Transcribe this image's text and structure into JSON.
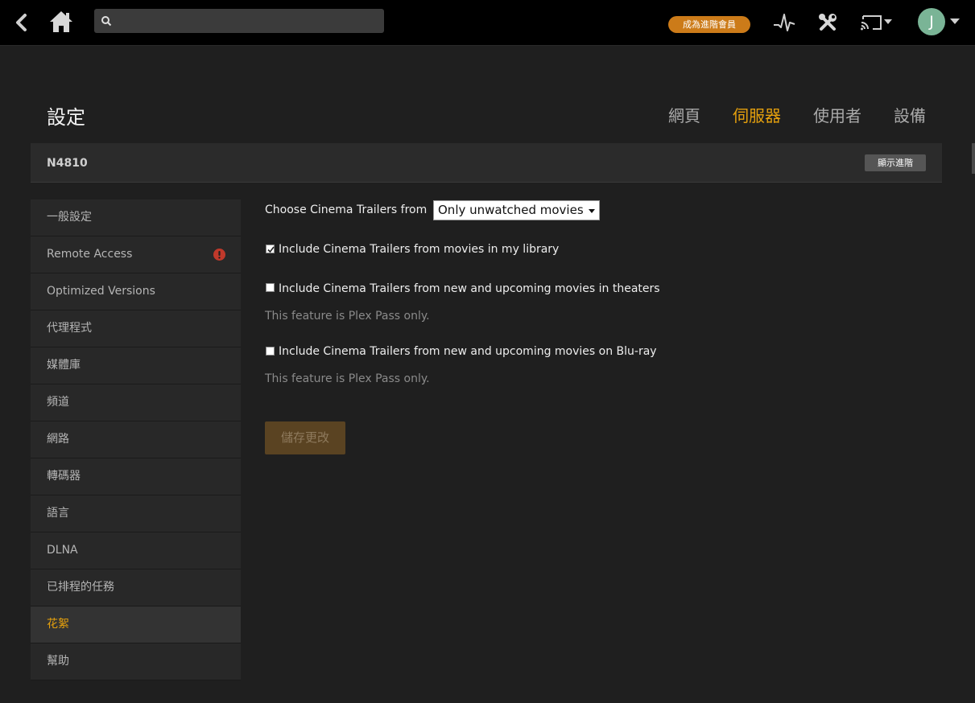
{
  "topbar": {
    "search_placeholder": "",
    "premium_label": "成為進階會員",
    "avatar_initial": "J"
  },
  "header": {
    "title": "設定",
    "tabs": [
      {
        "label": "網頁",
        "active": false
      },
      {
        "label": "伺服器",
        "active": true
      },
      {
        "label": "使用者",
        "active": false
      },
      {
        "label": "設備",
        "active": false
      }
    ]
  },
  "server": {
    "name": "N4810",
    "advanced_label": "顯示進階"
  },
  "sidebar": {
    "items": [
      {
        "label": "一般設定",
        "active": false
      },
      {
        "label": "Remote Access",
        "active": false,
        "alert": true
      },
      {
        "label": "Optimized Versions",
        "active": false
      },
      {
        "label": "代理程式",
        "active": false
      },
      {
        "label": "媒體庫",
        "active": false
      },
      {
        "label": "頻道",
        "active": false
      },
      {
        "label": "網路",
        "active": false
      },
      {
        "label": "轉碼器",
        "active": false
      },
      {
        "label": "語言",
        "active": false
      },
      {
        "label": "DLNA",
        "active": false
      },
      {
        "label": "已排程的任務",
        "active": false
      },
      {
        "label": "花絮",
        "active": true
      },
      {
        "label": "幫助",
        "active": false
      }
    ]
  },
  "form": {
    "trailers_from_label": "Choose Cinema Trailers from",
    "trailers_from_value": "Only unwatched movies",
    "options": [
      {
        "label": "Include Cinema Trailers from movies in my library",
        "checked": true,
        "note": ""
      },
      {
        "label": "Include Cinema Trailers from new and upcoming movies in theaters",
        "checked": false,
        "note": "This feature is Plex Pass only."
      },
      {
        "label": "Include Cinema Trailers from new and upcoming movies on Blu-ray",
        "checked": false,
        "note": "This feature is Plex Pass only."
      }
    ],
    "save_label": "儲存更改"
  },
  "colors": {
    "accent": "#e5a00d",
    "premium": "#cc7b19",
    "alert": "#c0392b",
    "avatar": "#7ab496"
  },
  "icons": [
    "back-icon",
    "home-icon",
    "search-icon",
    "activity-icon",
    "tools-icon",
    "cast-icon",
    "chevron-down-icon",
    "alert-icon",
    "checkmark-icon"
  ]
}
